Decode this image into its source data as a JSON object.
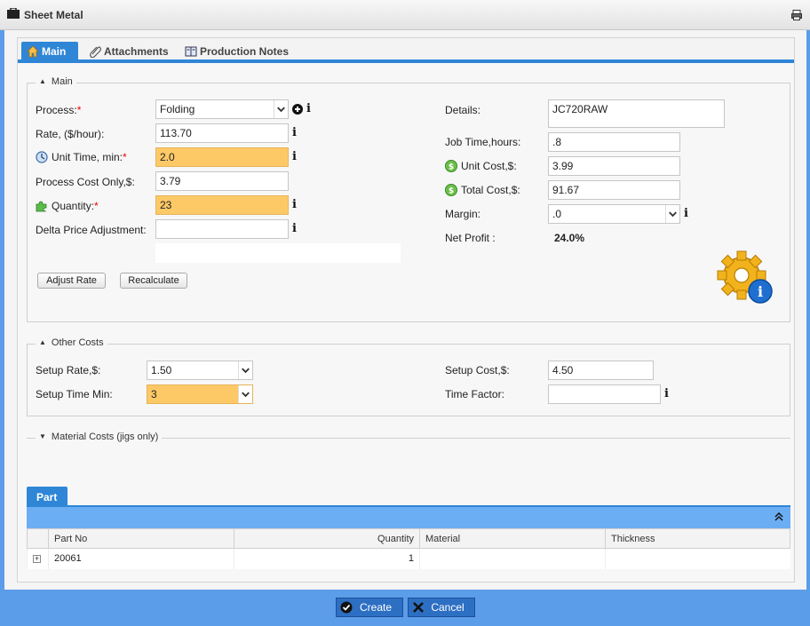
{
  "window": {
    "title": "Sheet Metal"
  },
  "tabs": [
    {
      "label": "Main",
      "icon": "home-icon"
    },
    {
      "label": "Attachments",
      "icon": "paperclip-icon"
    },
    {
      "label": "Production Notes",
      "icon": "notebook-icon"
    }
  ],
  "main_section": {
    "legend": "Main",
    "process": {
      "label": "Process:",
      "required": "*",
      "value": "Folding"
    },
    "rate": {
      "label": "Rate, ($/hour):",
      "value": "113.70"
    },
    "unit_time": {
      "label": "Unit Time, min:",
      "required": "*",
      "value": "2.0",
      "icon": "clock-icon"
    },
    "process_cost": {
      "label": "Process Cost Only,$:",
      "value": "3.79"
    },
    "quantity": {
      "label": "Quantity:",
      "required": "*",
      "value": "23",
      "icon": "puzzle-icon"
    },
    "delta_price": {
      "label": "Delta Price Adjustment:",
      "value": ""
    },
    "adjust_rate_button": "Adjust Rate",
    "recalculate_button": "Recalculate",
    "details": {
      "label": "Details:",
      "value": "JC720RAW"
    },
    "job_time": {
      "label": "Job Time,hours:",
      "value": ".8"
    },
    "unit_cost": {
      "label": "Unit Cost,$:",
      "value": "3.99",
      "icon": "dollar-coin-icon"
    },
    "total_cost": {
      "label": "Total Cost,$:",
      "value": "91.67",
      "icon": "dollar-coin-icon"
    },
    "margin": {
      "label": "Margin:",
      "value": ".0"
    },
    "net_profit": {
      "label": "Net Profit :",
      "value": "24.0%"
    },
    "info_glyph": "i"
  },
  "other_costs": {
    "legend": "Other Costs",
    "setup_rate": {
      "label": "Setup Rate,$:",
      "value": "1.50"
    },
    "setup_time": {
      "label": "Setup Time Min:",
      "value": "3"
    },
    "setup_cost": {
      "label": "Setup Cost,$:",
      "value": "4.50"
    },
    "time_factor": {
      "label": "Time Factor:",
      "value": ""
    }
  },
  "material_costs": {
    "legend": "Material Costs (jigs only)"
  },
  "part_grid": {
    "tab": "Part",
    "columns": [
      "Part No",
      "Quantity",
      "Material",
      "Thickness"
    ],
    "rows": [
      {
        "part_no": "20061",
        "quantity": "1",
        "material": "",
        "thickness": ""
      }
    ]
  },
  "footer": {
    "create_label": "Create",
    "cancel_label": "Cancel"
  },
  "colors": {
    "accent": "#2f86d7",
    "highlight": "#fdc967",
    "dialog_bg": "#5b9de8"
  }
}
